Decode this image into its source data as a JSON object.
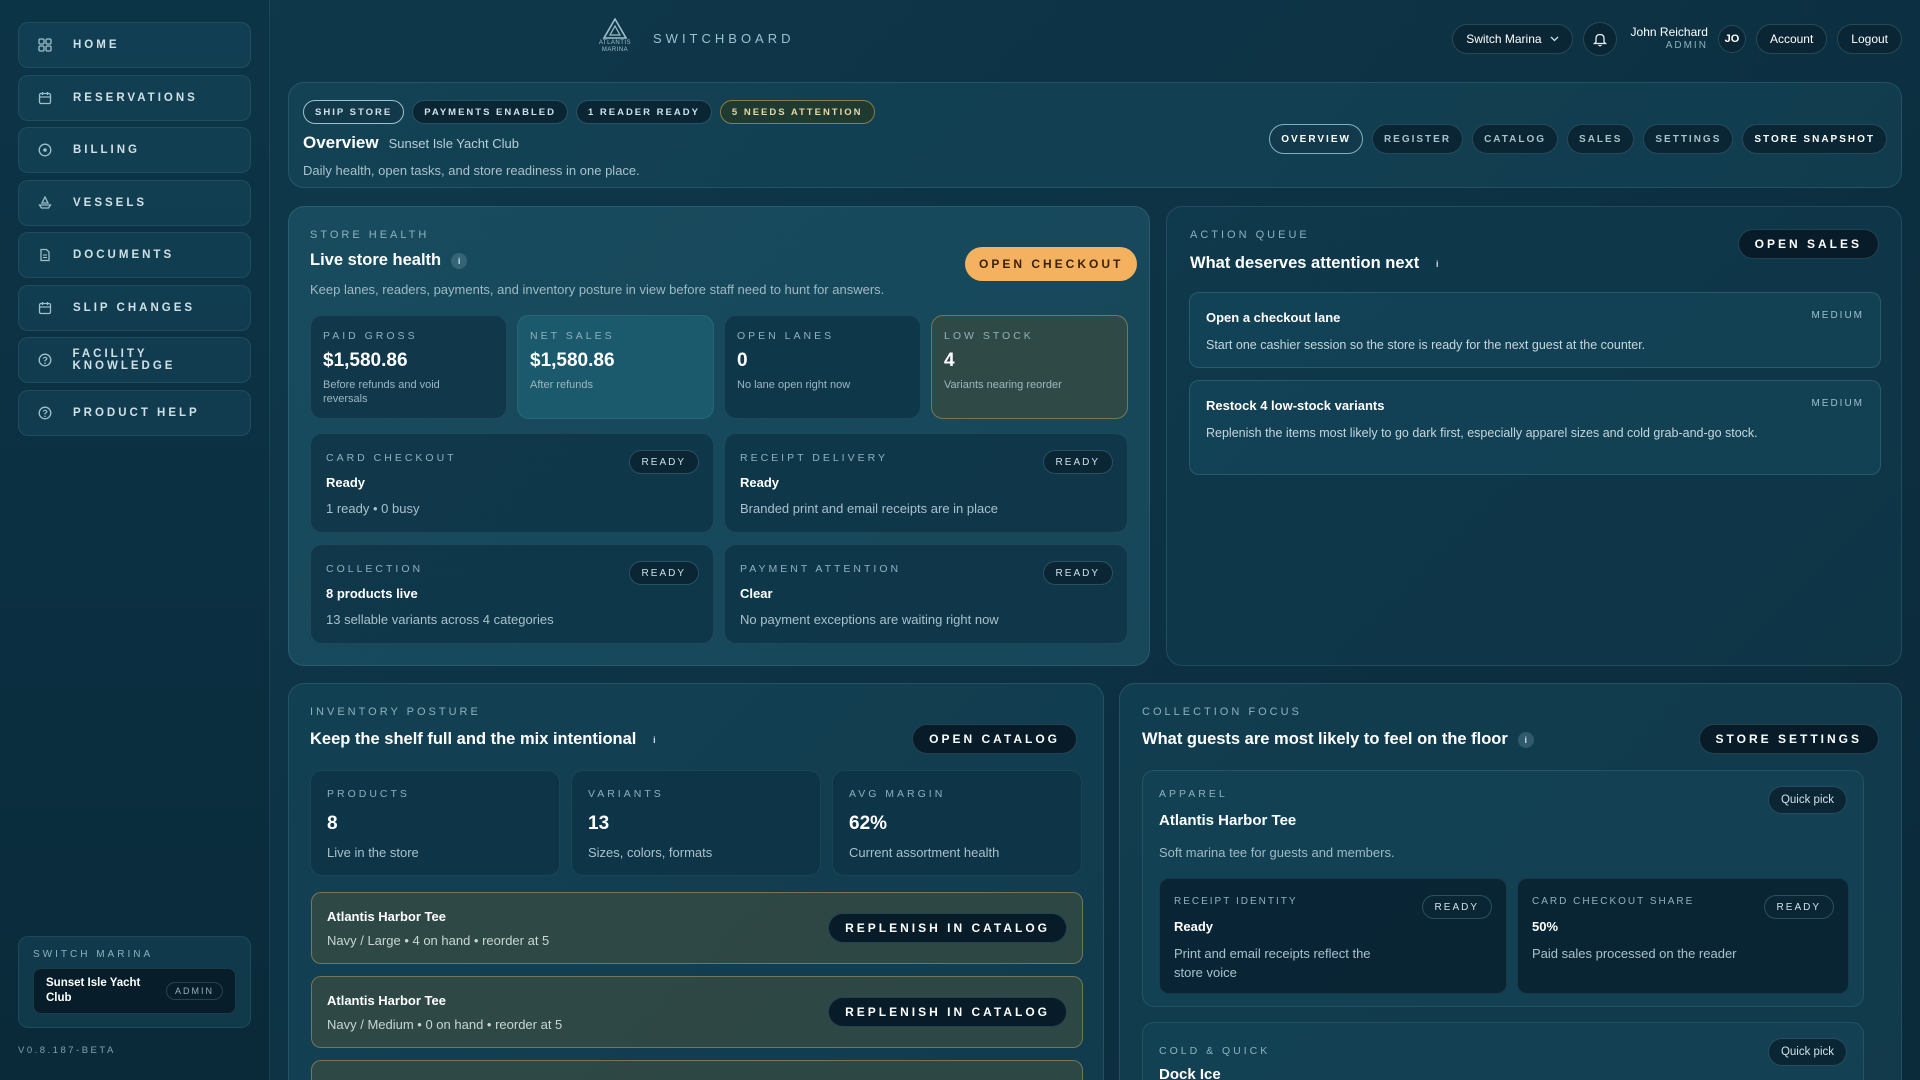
{
  "sidebar": {
    "items": [
      {
        "label": "HOME",
        "icon": "grid-icon"
      },
      {
        "label": "RESERVATIONS",
        "icon": "calendar-icon"
      },
      {
        "label": "BILLING",
        "icon": "dollar-icon"
      },
      {
        "label": "VESSELS",
        "icon": "boat-icon"
      },
      {
        "label": "DOCUMENTS",
        "icon": "document-icon"
      },
      {
        "label": "SLIP CHANGES",
        "icon": "calendar-icon"
      },
      {
        "label": "FACILITY KNOWLEDGE",
        "icon": "help-icon"
      },
      {
        "label": "PRODUCT HELP",
        "icon": "help-icon"
      }
    ],
    "marina_label": "SWITCH MARINA",
    "marina_name": "Sunset Isle Yacht Club",
    "marina_role": "ADMIN",
    "version": "V0.8.187-BETA"
  },
  "topbar": {
    "logo_text_1": "ATLANTIS",
    "logo_text_2": "MARINA",
    "brand": "SWITCHBOARD",
    "switch_marina": "Switch Marina",
    "user_name": "John Reichard",
    "user_role": "ADMIN",
    "avatar": "JO",
    "account": "Account",
    "logout": "Logout"
  },
  "header": {
    "badges": [
      "SHIP STORE",
      "PAYMENTS ENABLED",
      "1 READER READY",
      "5 NEEDS ATTENTION"
    ],
    "title": "Overview",
    "subtitle": "Sunset Isle Yacht Club",
    "description": "Daily health, open tasks, and store readiness in one place.",
    "tabs": [
      "OVERVIEW",
      "REGISTER",
      "CATALOG",
      "SALES",
      "SETTINGS",
      "STORE SNAPSHOT"
    ]
  },
  "store_health": {
    "kicker": "STORE HEALTH",
    "title": "Live store health",
    "info": "i",
    "description": "Keep lanes, readers, payments, and inventory posture in view before staff need to hunt for answers.",
    "button": "OPEN CHECKOUT",
    "stats": [
      {
        "label": "PAID GROSS",
        "value": "$1,580.86",
        "sub": "Before refunds and void reversals"
      },
      {
        "label": "NET SALES",
        "value": "$1,580.86",
        "sub": "After refunds"
      },
      {
        "label": "OPEN LANES",
        "value": "0",
        "sub": "No lane open right now"
      },
      {
        "label": "LOW STOCK",
        "value": "4",
        "sub": "Variants nearing reorder"
      }
    ],
    "readiness": [
      {
        "label": "CARD CHECKOUT",
        "badge": "READY",
        "status": "Ready",
        "desc": "1 ready • 0 busy"
      },
      {
        "label": "RECEIPT DELIVERY",
        "badge": "READY",
        "status": "Ready",
        "desc": "Branded print and email receipts are in place"
      },
      {
        "label": "COLLECTION",
        "badge": "READY",
        "status": "8 products live",
        "desc": "13 sellable variants across 4 categories"
      },
      {
        "label": "PAYMENT ATTENTION",
        "badge": "READY",
        "status": "Clear",
        "desc": "No payment exceptions are waiting right now"
      }
    ]
  },
  "action_queue": {
    "kicker": "ACTION QUEUE",
    "title": "What deserves attention next",
    "info": "i",
    "button": "OPEN SALES",
    "items": [
      {
        "title": "Open a checkout lane",
        "desc": "Start one cashier session so the store is ready for the next guest at the counter.",
        "priority": "MEDIUM"
      },
      {
        "title": "Restock 4 low-stock variants",
        "desc": "Replenish the items most likely to go dark first, especially apparel sizes and cold grab-and-go stock.",
        "priority": "MEDIUM"
      }
    ]
  },
  "inventory": {
    "kicker": "INVENTORY POSTURE",
    "title": "Keep the shelf full and the mix intentional",
    "info": "i",
    "button": "OPEN CATALOG",
    "stats": [
      {
        "label": "PRODUCTS",
        "value": "8",
        "sub": "Live in the store"
      },
      {
        "label": "VARIANTS",
        "value": "13",
        "sub": "Sizes, colors, formats"
      },
      {
        "label": "AVG MARGIN",
        "value": "62%",
        "sub": "Current assortment health"
      }
    ],
    "restock": [
      {
        "title": "Atlantis Harbor Tee",
        "desc": "Navy / Large • 4 on hand • reorder at 5",
        "button": "REPLENISH IN CATALOG"
      },
      {
        "title": "Atlantis Harbor Tee",
        "desc": "Navy / Medium • 0 on hand • reorder at 5",
        "button": "REPLENISH IN CATALOG"
      }
    ]
  },
  "collection_focus": {
    "kicker": "COLLECTION FOCUS",
    "title": "What guests are most likely to feel on the floor",
    "info": "i",
    "button": "STORE SETTINGS",
    "cards": [
      {
        "category": "APPAREL",
        "name": "Atlantis Harbor Tee",
        "desc": "Soft marina tee for guests and members.",
        "quick": "Quick pick",
        "subs": [
          {
            "label": "RECEIPT IDENTITY",
            "badge": "READY",
            "status": "Ready",
            "desc": "Print and email receipts reflect the store voice"
          },
          {
            "label": "CARD CHECKOUT SHARE",
            "badge": "READY",
            "status": "50%",
            "desc": "Paid sales processed on the reader"
          }
        ]
      },
      {
        "category": "COLD & QUICK",
        "name": "Dock Ice",
        "quick": "Quick pick"
      }
    ]
  }
}
